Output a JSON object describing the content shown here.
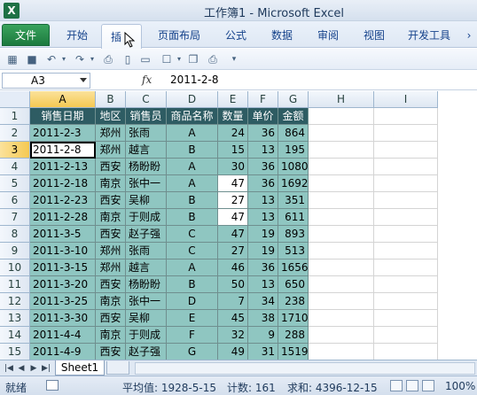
{
  "window": {
    "title": "工作簿1 - Microsoft Excel",
    "app_icon": "X"
  },
  "ribbon": {
    "tabs": [
      "文件",
      "开始",
      "插",
      "页面布局",
      "公式",
      "数据",
      "审阅",
      "视图",
      "开发工具"
    ],
    "active_tab": "插"
  },
  "formula_bar": {
    "name_box": "A3",
    "fx_label": "fx",
    "value": "2011-2-8"
  },
  "grid": {
    "columns": [
      "A",
      "B",
      "C",
      "D",
      "E",
      "F",
      "G",
      "H",
      "I"
    ],
    "selected_column": "A",
    "rows": [
      "1",
      "2",
      "3",
      "4",
      "5",
      "6",
      "7",
      "8",
      "9",
      "10",
      "11",
      "12",
      "13",
      "14",
      "15"
    ],
    "selected_row": "3",
    "headers": [
      "销售日期",
      "地区",
      "销售员",
      "商品名称",
      "数量",
      "单价",
      "金额"
    ],
    "data": [
      [
        "2011-2-3",
        "郑州",
        "张雨",
        "A",
        "24",
        "36",
        "864"
      ],
      [
        "2011-2-8",
        "郑州",
        "越言",
        "B",
        "15",
        "13",
        "195"
      ],
      [
        "2011-2-13",
        "西安",
        "杨盼盼",
        "A",
        "30",
        "36",
        "1080"
      ],
      [
        "2011-2-18",
        "南京",
        "张中一",
        "A",
        "47",
        "36",
        "1692"
      ],
      [
        "2011-2-23",
        "西安",
        "吴柳",
        "B",
        "27",
        "13",
        "351"
      ],
      [
        "2011-2-28",
        "南京",
        "于则成",
        "B",
        "47",
        "13",
        "611"
      ],
      [
        "2011-3-5",
        "西安",
        "赵子强",
        "C",
        "47",
        "19",
        "893"
      ],
      [
        "2011-3-10",
        "郑州",
        "张雨",
        "C",
        "27",
        "19",
        "513"
      ],
      [
        "2011-3-15",
        "郑州",
        "越言",
        "A",
        "46",
        "36",
        "1656"
      ],
      [
        "2011-3-20",
        "西安",
        "杨盼盼",
        "B",
        "50",
        "13",
        "650"
      ],
      [
        "2011-3-25",
        "南京",
        "张中一",
        "D",
        "7",
        "34",
        "238"
      ],
      [
        "2011-3-30",
        "西安",
        "吴柳",
        "E",
        "45",
        "38",
        "1710"
      ],
      [
        "2011-4-4",
        "南京",
        "于则成",
        "F",
        "32",
        "9",
        "288"
      ],
      [
        "2011-4-9",
        "西安",
        "赵子强",
        "G",
        "49",
        "31",
        "1519"
      ]
    ]
  },
  "sheets": {
    "tabs": [
      "Sheet1"
    ],
    "active": "Sheet1"
  },
  "status": {
    "ready": "就绪",
    "average": "平均值: 1928-5-15",
    "count": "计数: 161",
    "sum": "求和: 4396-12-15",
    "zoom": "100%"
  },
  "colors": {
    "header_fill": "#2e5c63",
    "body_fill": "#8fc6c1",
    "file_tab": "#1c7a3e"
  }
}
